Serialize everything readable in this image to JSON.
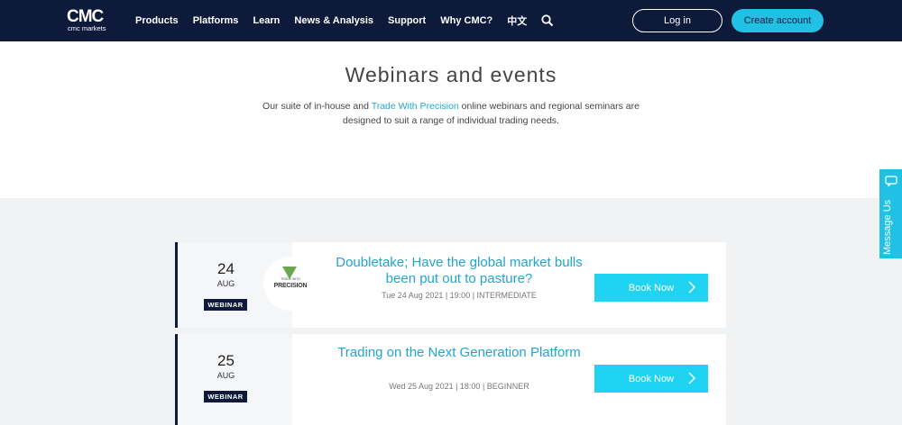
{
  "header": {
    "logo_text": "CMC",
    "logo_sub": "cmc markets",
    "nav": [
      "Products",
      "Platforms",
      "Learn",
      "News & Analysis",
      "Support",
      "Why CMC?",
      "中文"
    ],
    "login_label": "Log in",
    "create_account_label": "Create account"
  },
  "hero": {
    "title": "Webinars and events",
    "desc_pre": "Our suite of in-house and ",
    "desc_link": "Trade With Precision",
    "desc_post": " online webinars and regional seminars are designed to suit a range of individual trading needs."
  },
  "events": [
    {
      "day": "24",
      "month": "AUG",
      "type": "WEBINAR",
      "logo_small": "TRADE WITH",
      "logo_big": "PRECISION",
      "title": "Doubletake; Have the global market bulls been put out to pasture?",
      "meta": "Tue 24 Aug 2021 | 19:00 | INTERMEDIATE",
      "button": "Book Now"
    },
    {
      "day": "25",
      "month": "AUG",
      "type": "WEBINAR",
      "title": "Trading on the Next Generation Platform",
      "meta": "Wed 25 Aug 2021 | 18:00 | BEGINNER",
      "button": "Book Now"
    }
  ],
  "message_tab": {
    "label": "Message Us"
  },
  "colors": {
    "navy": "#0e1a3a",
    "accent": "#21c1e5",
    "link": "#21a5d0"
  },
  "icons": [
    "search-icon",
    "chevron-right-icon",
    "message-icon"
  ]
}
